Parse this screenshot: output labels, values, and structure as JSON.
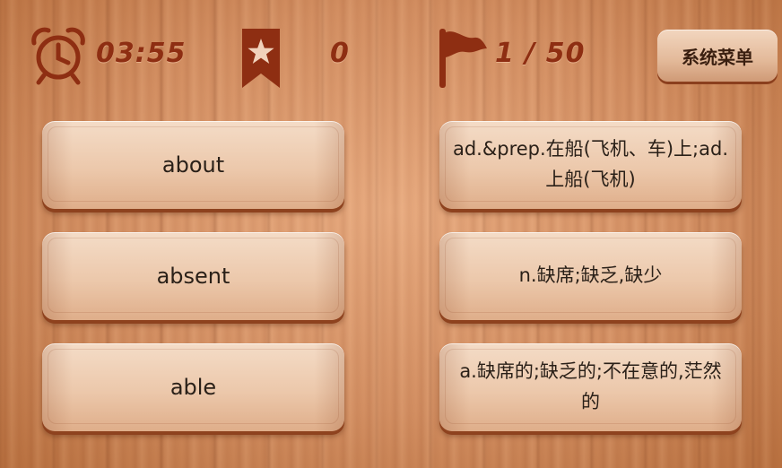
{
  "hud": {
    "timer": "03:55",
    "score": "0",
    "progress": "1 / 50",
    "icons": {
      "timer": "alarm-clock-icon",
      "score": "star-bookmark-icon",
      "progress": "flag-icon"
    },
    "colors": {
      "hud_text": "#8e2e12",
      "background": "#d28a5c",
      "button_face": "#ecc8ab"
    }
  },
  "menu": {
    "label": "系统菜单"
  },
  "words": [
    {
      "text": "about"
    },
    {
      "text": "absent"
    },
    {
      "text": "able"
    }
  ],
  "meanings": [
    {
      "text": "ad.&prep.在船(飞机、车)上;ad.上船(飞机)"
    },
    {
      "text": "n.缺席;缺乏,缺少"
    },
    {
      "text": "a.缺席的;缺乏的;不在意的,茫然的"
    }
  ]
}
